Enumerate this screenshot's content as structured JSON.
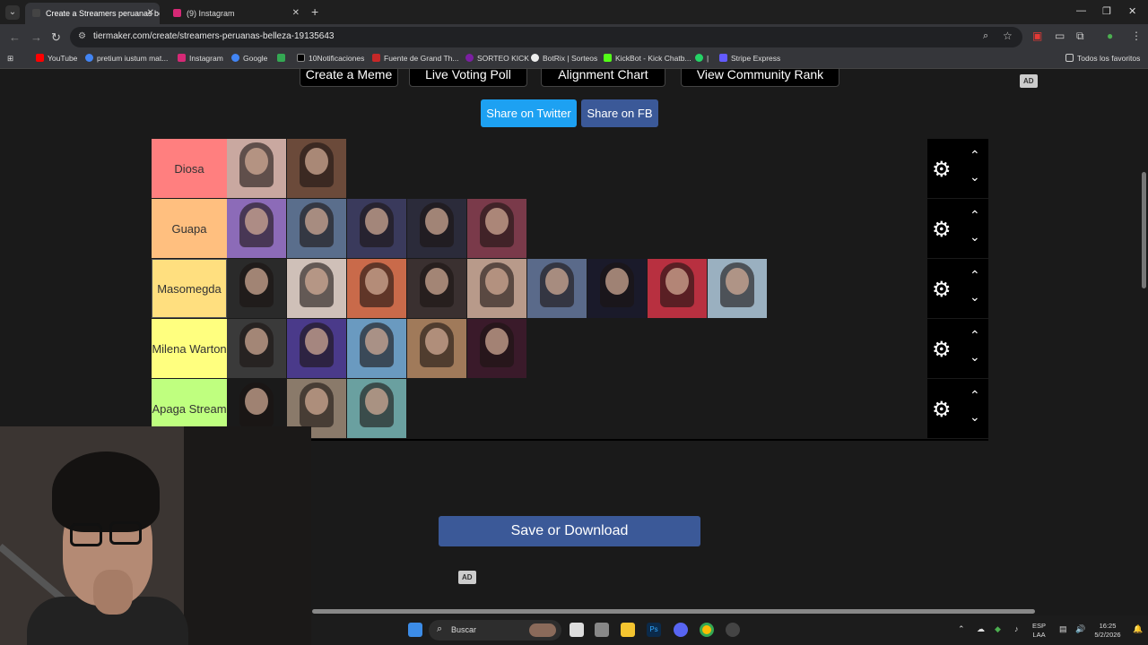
{
  "browser": {
    "tabs": [
      {
        "title": "Create a Streamers peruanas be",
        "active": true,
        "favicon_color": "#222222"
      },
      {
        "title": "(9) Instagram",
        "active": false,
        "favicon_color": "#d62976"
      }
    ],
    "url": "tiermaker.com/create/streamers-peruanas-belleza-19135643",
    "bookmarks": [
      {
        "label": "YouTube",
        "color": "#ff0000"
      },
      {
        "label": "pretium iustum mat...",
        "color": "#4285f4"
      },
      {
        "label": "Instagram",
        "color": "#d62976"
      },
      {
        "label": "Google",
        "color": "#4285f4"
      },
      {
        "label": "",
        "color": "#34a853"
      },
      {
        "label": "10Notificaciones",
        "color": "#000000"
      },
      {
        "label": "Fuente de Grand Th...",
        "color": "#c62828"
      },
      {
        "label": "SORTEO KICK",
        "color": "#7b1fa2"
      },
      {
        "label": "BotRix | Sorteos",
        "color": "#eeeeee"
      },
      {
        "label": "KickBot - Kick Chatb...",
        "color": "#53fc18"
      },
      {
        "label": "|",
        "color": "#25d366"
      },
      {
        "label": "Stripe Express",
        "color": "#635bff"
      }
    ],
    "other_bookmarks": "Todos los favoritos"
  },
  "page": {
    "top_buttons": [
      "Create a Meme",
      "Live Voting Poll",
      "Alignment Chart",
      "View Community Rank"
    ],
    "ad_label": "AD",
    "share_twitter": "Share on Twitter",
    "share_fb": "Share on FB",
    "save_button": "Save or Download",
    "tiers": [
      {
        "label": "Diosa",
        "color": "#ff7f7f",
        "items": 2,
        "thumb_colors": [
          "#c9a8a0",
          "#6b4a3a"
        ]
      },
      {
        "label": "Guapa",
        "color": "#ffbf7f",
        "items": 5,
        "thumb_colors": [
          "#8c6bb8",
          "#5a6e8c",
          "#3a3a5c",
          "#2b2b3a",
          "#7a3a4a"
        ]
      },
      {
        "label": "Masomegda",
        "color": "#ffdf7f",
        "items": 9,
        "thumb_colors": [
          "#2a2a2a",
          "#cfc0b8",
          "#c96a4a",
          "#3a3030",
          "#b89a8a",
          "#5a6a8a",
          "#1a1a2a",
          "#b83040",
          "#9ab0c0"
        ]
      },
      {
        "label": "Milena Warton",
        "color": "#ffff7f",
        "items": 5,
        "thumb_colors": [
          "#3a3a3a",
          "#4a3a8a",
          "#6a9ac0",
          "#a07a5a",
          "#3a1a2a"
        ]
      },
      {
        "label": "Apaga Stream",
        "color": "#bfff7f",
        "items": 3,
        "thumb_colors": [
          "#1a1a1a",
          "#8a7a6a",
          "#6aa0a0"
        ]
      }
    ]
  },
  "taskbar": {
    "search_placeholder": "Buscar",
    "lang_1": "ESP",
    "lang_2": "LAA",
    "time": "16:25",
    "date": "5/2/2026"
  }
}
